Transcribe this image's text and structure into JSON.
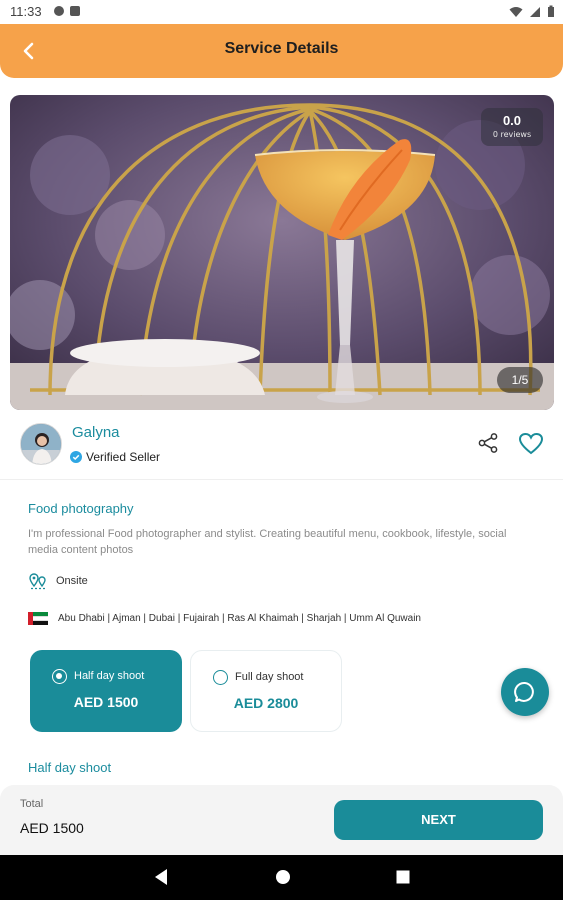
{
  "status_bar": {
    "time": "11:33"
  },
  "header": {
    "title": "Service Details"
  },
  "gallery": {
    "rating": "0.0",
    "reviews": "0 reviews",
    "counter": "1/5"
  },
  "seller": {
    "name": "Galyna",
    "verified_label": "Verified Seller"
  },
  "service": {
    "title": "Food photography",
    "description": "I'm professional Food photographer and stylist. Creating beautiful menu, cookbook, lifestyle, social media content photos",
    "location_type": "Onsite",
    "cities": "Abu Dhabi | Ajman | Dubai | Fujairah | Ras Al Khaimah | Sharjah | Umm Al Quwain"
  },
  "packages": [
    {
      "label": "Half day shoot",
      "price": "AED 1500",
      "selected": true
    },
    {
      "label": "Full day shoot",
      "price": "AED 2800",
      "selected": false
    }
  ],
  "selected_section": {
    "title": "Half day shoot"
  },
  "footer": {
    "total_label": "Total",
    "total_value": "AED 1500",
    "next_label": "NEXT"
  },
  "colors": {
    "accent": "#1a8c99",
    "header": "#f6a24a"
  }
}
